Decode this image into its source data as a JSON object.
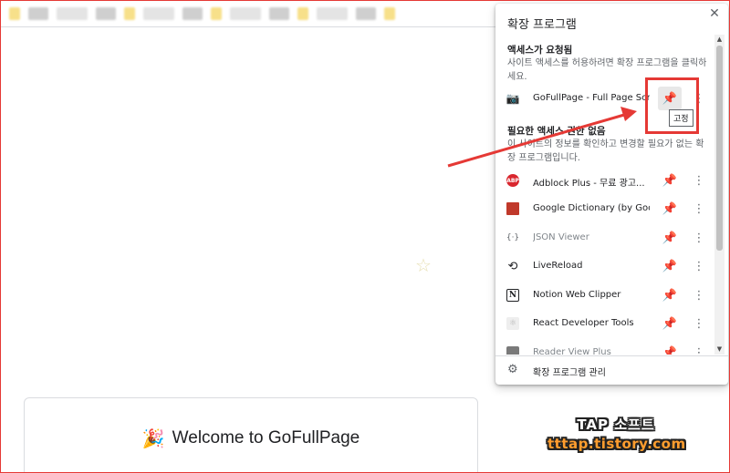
{
  "popup": {
    "title": "확장 프로그램",
    "close_glyph": "✕",
    "sections": {
      "requested": {
        "heading": "액세스가 요청됨",
        "description": "사이트 액세스를 허용하려면 확장 프로그램을 클릭하세요."
      },
      "no_access": {
        "heading": "필요한 액세스 권한 없음",
        "description": "이 사이트의 정보를 확인하고 변경할 필요가 없는 확장 프로그램입니다."
      }
    },
    "requested_extensions": [
      {
        "name": "GoFullPage - Full Page Scr...",
        "icon": "camera-icon",
        "pinned": false
      }
    ],
    "tooltip": "고정",
    "extensions": [
      {
        "name": "Adblock Plus - 무료 광고...",
        "icon": "adblock-plus-icon",
        "pinned": true
      },
      {
        "name": "Google Dictionary (by Goo...",
        "icon": "dictionary-icon",
        "pinned": true
      },
      {
        "name": "JSON Viewer",
        "icon": "json-icon",
        "pinned": false
      },
      {
        "name": "LiveReload",
        "icon": "reload-icon",
        "pinned": true
      },
      {
        "name": "Notion Web Clipper",
        "icon": "notion-icon",
        "pinned": true
      },
      {
        "name": "React Developer Tools",
        "icon": "react-icon",
        "pinned": true
      },
      {
        "name": "Reader View Plus",
        "icon": "reader-icon",
        "pinned": true
      }
    ],
    "footer_label": "확장 프로그램 관리",
    "icon_glyphs": {
      "pin": "📌",
      "more": "⋮",
      "gear": "⚙",
      "scroll_up": "▲",
      "scroll_down": "▼"
    }
  },
  "page": {
    "welcome_text": "Welcome to GoFullPage",
    "welcome_icon": "🎉",
    "star_glyph": "☆"
  },
  "watermark": {
    "line1": "TAP 소프트",
    "line2": "tttap.tistory.com"
  },
  "colors": {
    "accent_red": "#e53935",
    "pin_blue": "#1a73e8",
    "adblock_red": "#d9262e",
    "dictionary_red": "#c0392b"
  }
}
